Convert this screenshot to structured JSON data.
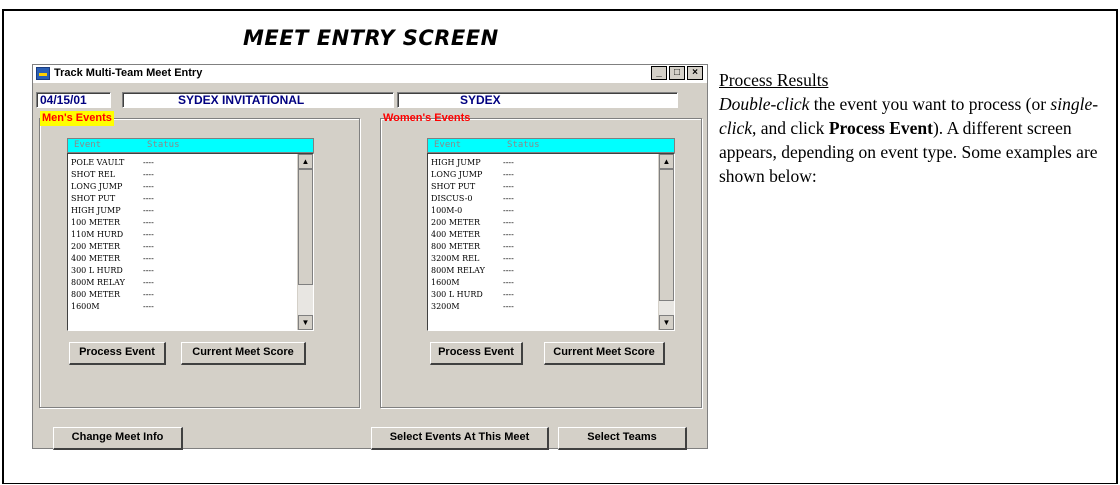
{
  "doc": {
    "title": "MEET ENTRY SCREEN"
  },
  "window": {
    "title": "Track Multi-Team Meet Entry",
    "controls": [
      "_",
      "□",
      "×"
    ],
    "date": "04/15/01",
    "meet_name": "SYDEX INVITATIONAL",
    "host": "SYDEX"
  },
  "mens": {
    "label": "Men's Events",
    "col_event": "Event",
    "col_status": "Status",
    "events": [
      {
        "event": "POLE VAULT",
        "status": "----"
      },
      {
        "event": "SHOT REL",
        "status": "----"
      },
      {
        "event": "LONG JUMP",
        "status": "----"
      },
      {
        "event": "SHOT PUT",
        "status": "----"
      },
      {
        "event": "HIGH JUMP",
        "status": "----"
      },
      {
        "event": "100 METER",
        "status": "----"
      },
      {
        "event": "110M HURD",
        "status": "----"
      },
      {
        "event": "200 METER",
        "status": "----"
      },
      {
        "event": "400 METER",
        "status": "----"
      },
      {
        "event": "300 L HURD",
        "status": "----"
      },
      {
        "event": "800M RELAY",
        "status": "----"
      },
      {
        "event": "800 METER",
        "status": "----"
      },
      {
        "event": "1600M",
        "status": "----"
      }
    ],
    "process_label": "Process Event",
    "score_label": "Current Meet Score"
  },
  "womens": {
    "label": "Women's Events",
    "col_event": "Event",
    "col_status": "Status",
    "events": [
      {
        "event": "HIGH JUMP",
        "status": "----"
      },
      {
        "event": "LONG JUMP",
        "status": "----"
      },
      {
        "event": "SHOT PUT",
        "status": "----"
      },
      {
        "event": "DISCUS-0",
        "status": "----"
      },
      {
        "event": "100M-0",
        "status": "----"
      },
      {
        "event": "200 METER",
        "status": "----"
      },
      {
        "event": "400 METER",
        "status": "----"
      },
      {
        "event": "800 METER",
        "status": "----"
      },
      {
        "event": "3200M REL",
        "status": "----"
      },
      {
        "event": "800M RELAY",
        "status": "----"
      },
      {
        "event": "1600M",
        "status": "----"
      },
      {
        "event": "300 L HURD",
        "status": "----"
      },
      {
        "event": "3200M",
        "status": "----"
      }
    ],
    "process_label": "Process Event",
    "score_label": "Current Meet Score"
  },
  "bottom": {
    "change_label": "Change Meet Info",
    "select_events_label": "Select Events At This Meet",
    "select_teams_label": "Select Teams"
  },
  "description": {
    "heading": "Process Results",
    "p1": "Double-click",
    "p2": " the event you want to process (or ",
    "p3": "single-click",
    "p4": ", and click ",
    "p5": "Process Event",
    "p6": ").  A different screen appears, depending on event type.  Some examples are shown below:"
  },
  "colors": {
    "list_header": "#00ffff",
    "group_label_bg": "#ffff00",
    "group_label_fg": "#ff0000",
    "field_text": "#000080",
    "window_bg": "#d4d0c8"
  }
}
